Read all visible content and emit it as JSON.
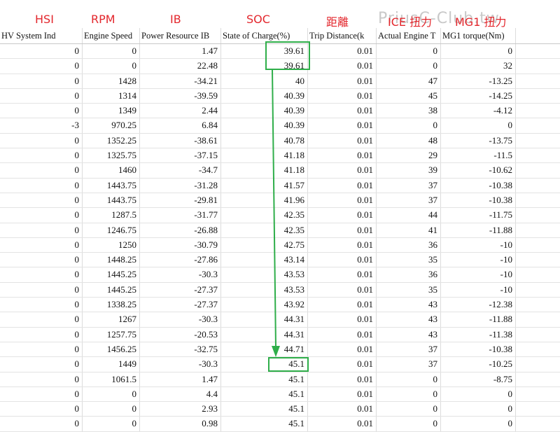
{
  "watermark": "PriusC-Club.tw",
  "annotations": [
    "HSI",
    "RPM",
    "IB",
    "SOC",
    "距離",
    "ICE 扭力",
    "MG1 扭力"
  ],
  "columns": [
    "HV System Ind",
    "Engine Speed",
    "Power Resource IB",
    "State of Charge(%)",
    "Trip Distance(k",
    "Actual Engine T",
    "MG1 torque(Nm)"
  ],
  "rows": [
    [
      "0",
      "0",
      "1.47",
      "39.61",
      "0.01",
      "0",
      "0"
    ],
    [
      "0",
      "0",
      "22.48",
      "39.61",
      "0.01",
      "0",
      "32"
    ],
    [
      "0",
      "1428",
      "-34.21",
      "40",
      "0.01",
      "47",
      "-13.25"
    ],
    [
      "0",
      "1314",
      "-39.59",
      "40.39",
      "0.01",
      "45",
      "-14.25"
    ],
    [
      "0",
      "1349",
      "2.44",
      "40.39",
      "0.01",
      "38",
      "-4.12"
    ],
    [
      "-3",
      "970.25",
      "6.84",
      "40.39",
      "0.01",
      "0",
      "0"
    ],
    [
      "0",
      "1352.25",
      "-38.61",
      "40.78",
      "0.01",
      "48",
      "-13.75"
    ],
    [
      "0",
      "1325.75",
      "-37.15",
      "41.18",
      "0.01",
      "29",
      "-11.5"
    ],
    [
      "0",
      "1460",
      "-34.7",
      "41.18",
      "0.01",
      "39",
      "-10.62"
    ],
    [
      "0",
      "1443.75",
      "-31.28",
      "41.57",
      "0.01",
      "37",
      "-10.38"
    ],
    [
      "0",
      "1443.75",
      "-29.81",
      "41.96",
      "0.01",
      "37",
      "-10.38"
    ],
    [
      "0",
      "1287.5",
      "-31.77",
      "42.35",
      "0.01",
      "44",
      "-11.75"
    ],
    [
      "0",
      "1246.75",
      "-26.88",
      "42.35",
      "0.01",
      "41",
      "-11.88"
    ],
    [
      "0",
      "1250",
      "-30.79",
      "42.75",
      "0.01",
      "36",
      "-10"
    ],
    [
      "0",
      "1448.25",
      "-27.86",
      "43.14",
      "0.01",
      "35",
      "-10"
    ],
    [
      "0",
      "1445.25",
      "-30.3",
      "43.53",
      "0.01",
      "36",
      "-10"
    ],
    [
      "0",
      "1445.25",
      "-27.37",
      "43.53",
      "0.01",
      "35",
      "-10"
    ],
    [
      "0",
      "1338.25",
      "-27.37",
      "43.92",
      "0.01",
      "43",
      "-12.38"
    ],
    [
      "0",
      "1267",
      "-30.3",
      "44.31",
      "0.01",
      "43",
      "-11.88"
    ],
    [
      "0",
      "1257.75",
      "-20.53",
      "44.31",
      "0.01",
      "43",
      "-11.38"
    ],
    [
      "0",
      "1456.25",
      "-32.75",
      "44.71",
      "0.01",
      "37",
      "-10.38"
    ],
    [
      "0",
      "1449",
      "-30.3",
      "45.1",
      "0.01",
      "37",
      "-10.25"
    ],
    [
      "0",
      "1061.5",
      "1.47",
      "45.1",
      "0.01",
      "0",
      "-8.75"
    ],
    [
      "0",
      "0",
      "4.4",
      "45.1",
      "0.01",
      "0",
      "0"
    ],
    [
      "0",
      "0",
      "2.93",
      "45.1",
      "0.01",
      "0",
      "0"
    ],
    [
      "0",
      "0",
      "0.98",
      "45.1",
      "0.01",
      "0",
      "0"
    ]
  ],
  "colors": {
    "annotation": "#e3272d",
    "highlight": "#2fae4a",
    "watermark": "#c9c9c9"
  }
}
